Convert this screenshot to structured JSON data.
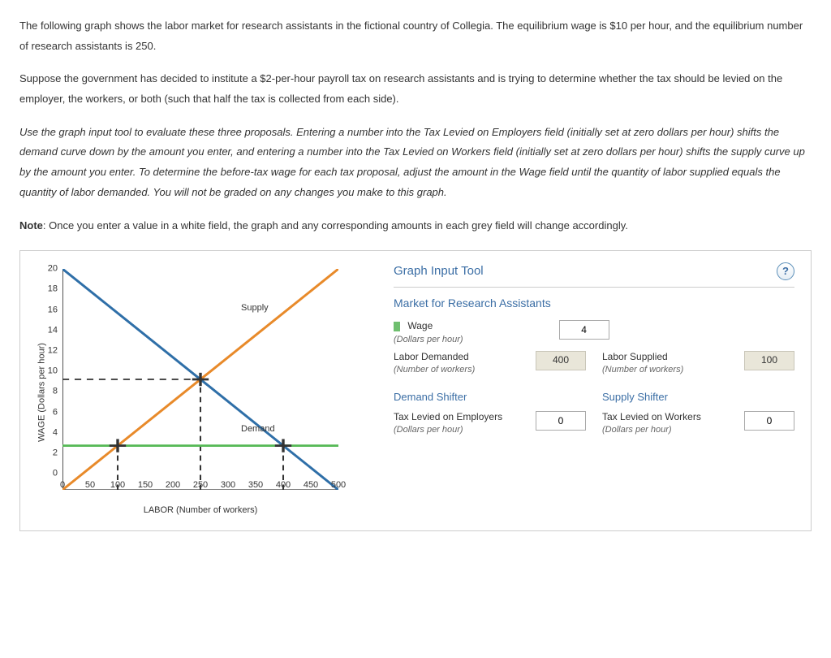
{
  "intro": {
    "p1": "The following graph shows the labor market for research assistants in the fictional country of Collegia. The equilibrium wage is $10 per hour, and the equilibrium number of research assistants is 250.",
    "p2": "Suppose the government has decided to institute a $2-per-hour payroll tax on research assistants and is trying to determine whether the tax should be levied on the employer, the workers, or both (such that half the tax is collected from each side).",
    "p3_italic": "Use the graph input tool to evaluate these three proposals. Entering a number into the Tax Levied on Employers field (initially set at zero dollars per hour) shifts the demand curve down by the amount you enter, and entering a number into the Tax Levied on Workers field (initially set at zero dollars per hour) shifts the supply curve up by the amount you enter. To determine the before-tax wage for each tax proposal, adjust the amount in the Wage field until the quantity of labor supplied equals the quantity of labor demanded. You will not be graded on any changes you make to this graph.",
    "note_label": "Note",
    "note_text": ": Once you enter a value in a white field, the graph and any corresponding amounts in each grey field will change accordingly."
  },
  "chart_data": {
    "type": "line",
    "xlabel": "LABOR (Number of workers)",
    "ylabel": "WAGE (Dollars per hour)",
    "xlim": [
      0,
      500
    ],
    "ylim": [
      0,
      20
    ],
    "x_ticks": [
      0,
      50,
      100,
      150,
      200,
      250,
      300,
      350,
      400,
      450,
      500
    ],
    "y_ticks": [
      0,
      2,
      4,
      6,
      8,
      10,
      12,
      14,
      16,
      18,
      20
    ],
    "series": [
      {
        "name": "Supply",
        "color": "#e88a2a",
        "points": [
          [
            0,
            0
          ],
          [
            500,
            20
          ]
        ]
      },
      {
        "name": "Demand",
        "color": "#2f6fa8",
        "points": [
          [
            0,
            20
          ],
          [
            500,
            0
          ]
        ]
      },
      {
        "name": "Wage line",
        "color": "#55b955",
        "points": [
          [
            0,
            4
          ],
          [
            500,
            4
          ]
        ]
      }
    ],
    "guides": {
      "dash_h": {
        "y": 10,
        "x_to": 250
      },
      "dash_v1": {
        "x": 100,
        "y_to": 4
      },
      "dash_v2": {
        "x": 250,
        "y_to": 10
      },
      "dash_v3": {
        "x": 400,
        "y_to": 4
      }
    },
    "labels": {
      "supply": "Supply",
      "demand": "Demand"
    },
    "intersection": {
      "x": 250,
      "y": 10
    },
    "wage_markers": [
      {
        "x": 100,
        "y": 4
      },
      {
        "x": 400,
        "y": 4
      }
    ]
  },
  "tool": {
    "title": "Graph Input Tool",
    "help": "?",
    "market_title": "Market for Research Assistants",
    "wage_label": "Wage",
    "wage_sub": "(Dollars per hour)",
    "wage_value": "4",
    "labor_demanded_label": "Labor Demanded",
    "labor_demanded_sub": "(Number of workers)",
    "labor_demanded_value": "400",
    "labor_supplied_label": "Labor Supplied",
    "labor_supplied_sub": "(Number of workers)",
    "labor_supplied_value": "100",
    "demand_shifter_title": "Demand Shifter",
    "supply_shifter_title": "Supply Shifter",
    "tax_emp_label": "Tax Levied on Employers",
    "tax_emp_sub": "(Dollars per hour)",
    "tax_emp_value": "0",
    "tax_work_label": "Tax Levied on Workers",
    "tax_work_sub": "(Dollars per hour)",
    "tax_work_value": "0"
  }
}
